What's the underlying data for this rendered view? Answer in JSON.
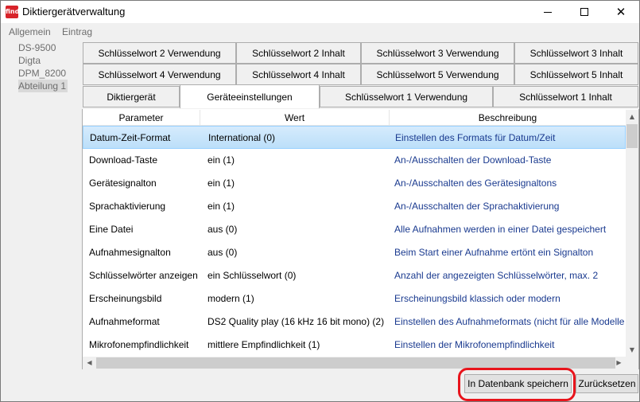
{
  "window": {
    "title": "Diktiergerätverwaltung",
    "icon_label": "find"
  },
  "menu": {
    "items": [
      "Allgemein",
      "Eintrag"
    ]
  },
  "tree": {
    "items": [
      "DS-9500",
      "Digta",
      "DPM_8200",
      "Abteilung 1"
    ],
    "selected_index": 3
  },
  "tabs": {
    "row1": [
      "Schlüsselwort 2 Verwendung",
      "Schlüsselwort 2 Inhalt",
      "Schlüsselwort 3 Verwendung",
      "Schlüsselwort 3 Inhalt"
    ],
    "row2": [
      "Schlüsselwort 4 Verwendung",
      "Schlüsselwort 4 Inhalt",
      "Schlüsselwort 5 Verwendung",
      "Schlüsselwort 5 Inhalt"
    ],
    "row3": [
      "Diktiergerät",
      "Geräteeinstellungen",
      "Schlüsselwort 1 Verwendung",
      "Schlüsselwort 1 Inhalt"
    ],
    "active": "Geräteeinstellungen"
  },
  "grid": {
    "columns": [
      "Parameter",
      "Wert",
      "Beschreibung"
    ],
    "rows": [
      {
        "param": "Datum-Zeit-Format",
        "value": "International (0)",
        "desc": "Einstellen des Formats für Datum/Zeit"
      },
      {
        "param": "Download-Taste",
        "value": "ein (1)",
        "desc": "An-/Ausschalten der Download-Taste"
      },
      {
        "param": "Gerätesignalton",
        "value": "ein (1)",
        "desc": "An-/Ausschalten des Gerätesignaltons"
      },
      {
        "param": "Sprachaktivierung",
        "value": "ein (1)",
        "desc": "An-/Ausschalten der Sprachaktivierung"
      },
      {
        "param": "Eine Datei",
        "value": "aus (0)",
        "desc": "Alle Aufnahmen werden in einer Datei gespeichert"
      },
      {
        "param": "Aufnahmesignalton",
        "value": "aus (0)",
        "desc": "Beim Start einer Aufnahme ertönt ein Signalton"
      },
      {
        "param": "Schlüsselwörter anzeigen",
        "value": "ein Schlüsselwort (0)",
        "desc": "Anzahl der angezeigten Schlüsselwörter, max. 2"
      },
      {
        "param": "Erscheinungsbild",
        "value": "modern (1)",
        "desc": "Erscheinungsbild klassich oder modern"
      },
      {
        "param": "Aufnahmeformat",
        "value": "DS2 Quality play (16 kHz 16 bit mono) (2)",
        "desc": "Einstellen des Aufnahmeformats (nicht für alle Modelle"
      },
      {
        "param": "Mikrofonempfindlichkeit",
        "value": "mittlere Empfindlichkeit (1)",
        "desc": "Einstellen der Mikrofonempfindlichkeit"
      }
    ],
    "selected_index": 0
  },
  "buttons": {
    "save": "In Datenbank speichern",
    "reset": "Zurücksetzen"
  },
  "colors": {
    "selection": "#cce8ff",
    "description_text": "#1a3a8f",
    "highlight_ring": "#e8141c"
  }
}
